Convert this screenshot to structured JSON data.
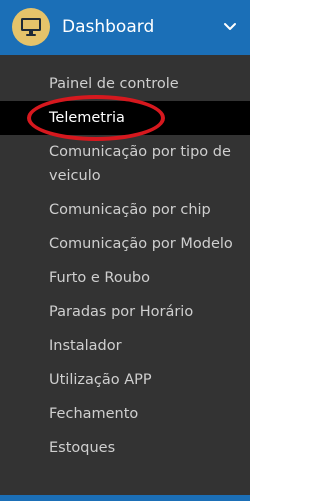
{
  "header": {
    "title": "Dashboard",
    "icon": "monitor-icon",
    "chevron": "chevron-down-icon",
    "accent_color": "#1b6fb7",
    "icon_badge_color": "#e5c36a"
  },
  "menu": {
    "items": [
      {
        "label": "Painel de controle"
      },
      {
        "label": "Telemetria",
        "active": true
      },
      {
        "label": "Comunicação por tipo de veiculo"
      },
      {
        "label": "Comunicação por chip"
      },
      {
        "label": "Comunicação por Modelo"
      },
      {
        "label": "Furto e Roubo"
      },
      {
        "label": "Paradas por Horário"
      },
      {
        "label": "Instalador"
      },
      {
        "label": "Utilização APP"
      },
      {
        "label": "Fechamento"
      },
      {
        "label": "Estoques"
      }
    ]
  },
  "highlight_color": "#d6181e"
}
